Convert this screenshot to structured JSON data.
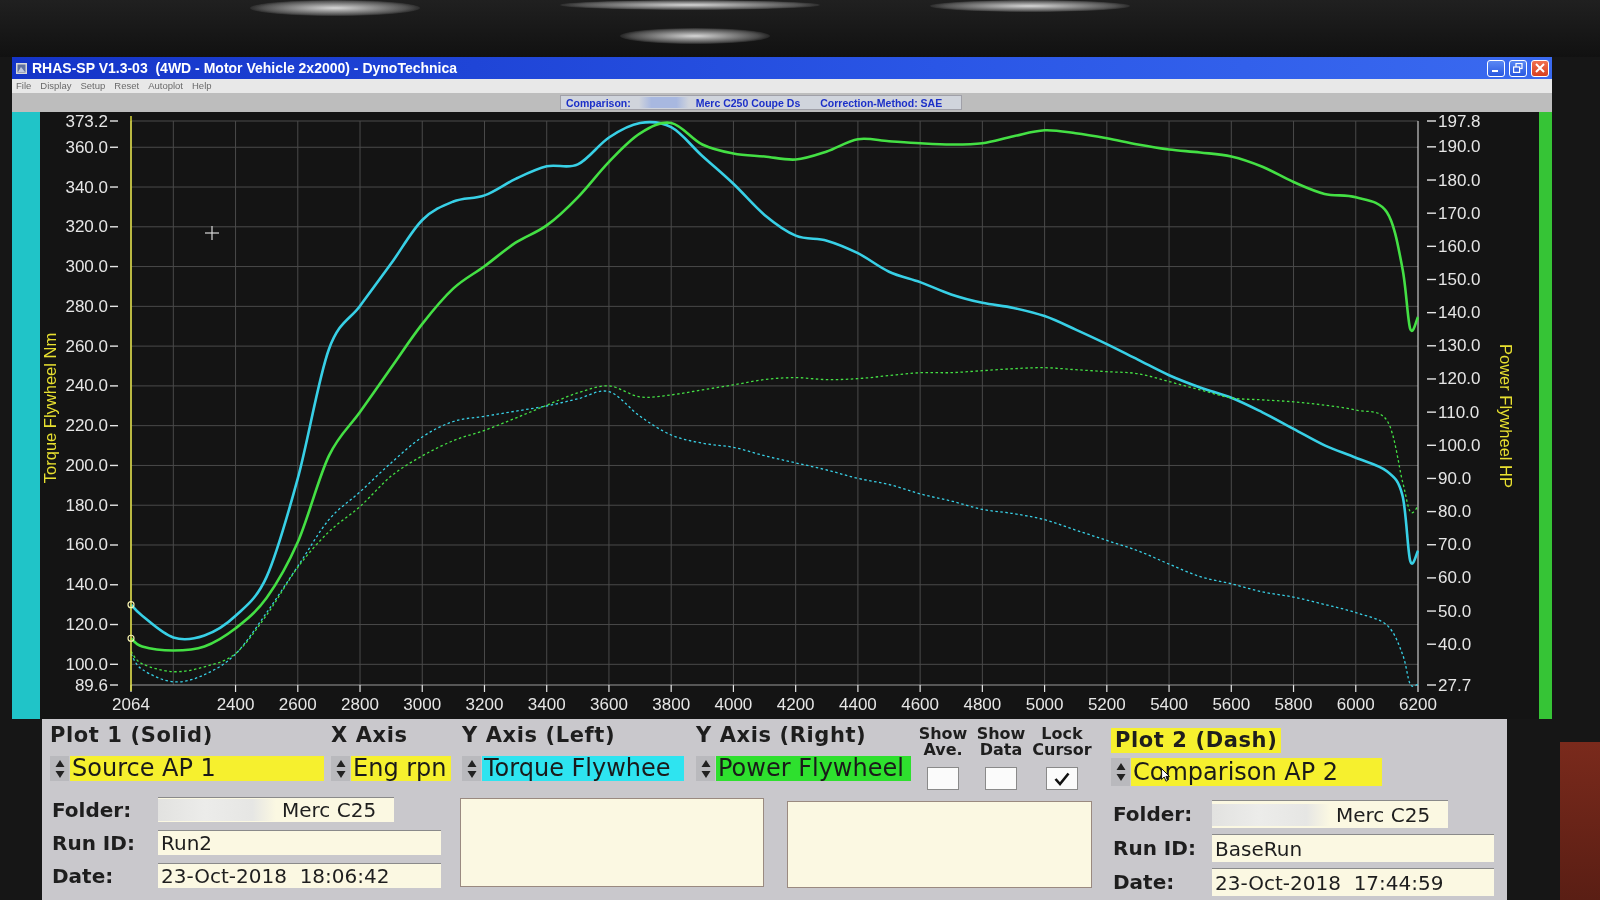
{
  "window": {
    "title": "RHAS-SP V1.3-03  (4WD - Motor Vehicle 2x2000) - DynoTechnica"
  },
  "menu": [
    "File",
    "Display",
    "Setup",
    "Reset",
    "Autoplot",
    "Help"
  ],
  "comparison_bar": {
    "label": "Comparison:",
    "redacted": true,
    "vehicle": "Merc C250 Coupe Ds",
    "correction": "Correction-Method: SAE"
  },
  "chart": {
    "chart_data": {
      "type": "line",
      "ylabel": "Torque Flywheel Nm",
      "y2label": "Power Flywheel HP",
      "grid": true,
      "x": [
        2064,
        2100,
        2200,
        2300,
        2400,
        2500,
        2600,
        2700,
        2800,
        2900,
        3000,
        3100,
        3200,
        3300,
        3400,
        3500,
        3600,
        3700,
        3800,
        3900,
        4000,
        4100,
        4200,
        4300,
        4400,
        4500,
        4600,
        4700,
        4800,
        4900,
        5000,
        5100,
        5200,
        5300,
        5400,
        5500,
        5600,
        5700,
        5800,
        5900,
        6000,
        6100,
        6150,
        6175,
        6200
      ],
      "xlim": [
        2064,
        6200
      ],
      "xticks": [
        2064,
        2400,
        2600,
        2800,
        3000,
        3200,
        3400,
        3600,
        3800,
        4000,
        4200,
        4400,
        4600,
        4800,
        5000,
        5200,
        5400,
        5600,
        5800,
        6000,
        6200
      ],
      "ylim": [
        89.6,
        373.2
      ],
      "yticks": [
        89.6,
        {
          "value": 100,
          "label": "100.0"
        },
        {
          "value": 120,
          "label": "120.0"
        },
        {
          "value": 140,
          "label": "140.0"
        },
        {
          "value": 160,
          "label": "160.0"
        },
        {
          "value": 180,
          "label": "180.0"
        },
        {
          "value": 200,
          "label": "200.0"
        },
        {
          "value": 220,
          "label": "220.0"
        },
        {
          "value": 240,
          "label": "240.0"
        },
        {
          "value": 260,
          "label": "260.0"
        },
        {
          "value": 280,
          "label": "280.0"
        },
        {
          "value": 300,
          "label": "300.0"
        },
        {
          "value": 320,
          "label": "320.0"
        },
        {
          "value": 340,
          "label": "340.0"
        },
        {
          "value": 360,
          "label": "360.0"
        },
        373.2
      ],
      "y2lim": [
        27.7,
        197.8
      ],
      "y2ticks": [
        27.7,
        {
          "value": 40,
          "label": "40.0"
        },
        {
          "value": 50,
          "label": "50.0"
        },
        {
          "value": 60,
          "label": "60.0"
        },
        {
          "value": 70,
          "label": "70.0"
        },
        {
          "value": 80,
          "label": "80.0"
        },
        {
          "value": 90,
          "label": "90.0"
        },
        {
          "value": 100,
          "label": "100.0"
        },
        {
          "value": 110,
          "label": "110.0"
        },
        {
          "value": 120,
          "label": "120.0"
        },
        {
          "value": 130,
          "label": "130.0"
        },
        {
          "value": 140,
          "label": "140.0"
        },
        {
          "value": 150,
          "label": "150.0"
        },
        {
          "value": 160,
          "label": "160.0"
        },
        {
          "value": 170,
          "label": "170.0"
        },
        {
          "value": 180,
          "label": "180.0"
        },
        {
          "value": 190,
          "label": "190.0"
        },
        197.8
      ],
      "series": [
        {
          "color": "#38d0e6",
          "line_style": "solid",
          "values": [
            130,
            124.4,
            113.5,
            114.5,
            124.4,
            144.1,
            193.5,
            258.4,
            280.2,
            301.5,
            323.4,
            332.7,
            335.8,
            344.1,
            350.4,
            351.4,
            364.9,
            372.2,
            370.1,
            355.6,
            341.6,
            326,
            315.6,
            313,
            306.7,
            297.4,
            292.2,
            286,
            281.8,
            279.2,
            275.1,
            268.3,
            261,
            253.2,
            245.4,
            239.2,
            234,
            226.7,
            218.4,
            210.1,
            203.9,
            197.1,
            185,
            152,
            157.1
          ]
        },
        {
          "color": "#44e044",
          "line_style": "solid",
          "axis": "y2",
          "values": [
            41.8,
            39.3,
            38.1,
            39.3,
            44.8,
            54,
            70.8,
            96.8,
            110,
            123.4,
            136.6,
            147.3,
            154,
            161.1,
            166.3,
            174.8,
            185.5,
            194.1,
            197.2,
            190.7,
            188,
            187.1,
            186.2,
            188.6,
            192.3,
            191.7,
            191.1,
            190.7,
            191.1,
            193.2,
            195,
            194.1,
            192.6,
            190.7,
            189.2,
            188.3,
            187.1,
            184,
            179.4,
            175.8,
            174.8,
            170.3,
            153.4,
            135.1,
            138.7
          ]
        },
        {
          "color": "#38d0e6",
          "line_style": "dashed",
          "values": [
            105.2,
            97.4,
            91.2,
            94.8,
            105.2,
            126,
            149.3,
            172.7,
            186.7,
            201.3,
            214.3,
            222.1,
            224.7,
            227.3,
            229.9,
            233.5,
            237.1,
            224.7,
            215.3,
            211.2,
            209.1,
            204.9,
            201.3,
            197.7,
            193.5,
            190.4,
            185.7,
            182.1,
            177.9,
            175.8,
            172.7,
            167.5,
            162.3,
            157.1,
            150.4,
            144.1,
            140.5,
            136.4,
            133.8,
            130.1,
            126,
            119.7,
            105.2,
            90,
            90
          ]
        },
        {
          "color": "#44e044",
          "line_style": "dashed",
          "axis": "y2",
          "values": [
            37.8,
            34.1,
            31.7,
            33.2,
            37.2,
            48.8,
            63.2,
            73.9,
            81.5,
            90.7,
            96.8,
            101.4,
            104.5,
            108.2,
            112.1,
            115.8,
            117.9,
            114.6,
            115.2,
            116.7,
            118.2,
            119.8,
            120.4,
            119.8,
            120.1,
            121,
            121.9,
            121.9,
            122.5,
            123.1,
            123.4,
            122.8,
            122.2,
            121.6,
            119.2,
            116.7,
            114.3,
            113.7,
            113.1,
            112.1,
            110.6,
            107.5,
            89.2,
            80,
            81.5
          ]
        }
      ],
      "ref_lines": [
        {
          "axis": "x",
          "value": 2064
        }
      ]
    }
  },
  "plot_1": {
    "title": "Plot 1 (Solid)",
    "highlighted": false,
    "source": {
      "value": "Source AP 1",
      "color": "#f6f02e"
    },
    "info": [
      {
        "label": "Folder:",
        "value": "Merc C25",
        "redacted": true
      },
      {
        "label": "Run ID:",
        "value": "Run2",
        "redacted": false
      },
      {
        "label": "Date:",
        "value": "23-Oct-2018  18:06:42",
        "redacted": false
      }
    ]
  },
  "axes": [
    {
      "header": "X Axis",
      "value": "Eng rpn",
      "color": "#f6f02e"
    },
    {
      "header": "Y Axis (Left)",
      "value": "Torque Flywhee",
      "color": "#2ee4f0"
    },
    {
      "header": "Y Axis (Right)",
      "value": "Power Flywheel",
      "color": "#2ee02e"
    }
  ],
  "options": [
    {
      "label": "Show Ave.",
      "checked": false
    },
    {
      "label": "Show Data",
      "checked": false
    },
    {
      "label": "Lock Cursor",
      "checked": true
    }
  ],
  "plot_2": {
    "title": "Plot 2 (Dash)",
    "highlighted": true,
    "source": {
      "value": "Comparison AP 2",
      "color": "#f6f02e"
    },
    "info": [
      {
        "label": "Folder:",
        "value": "Merc C25",
        "redacted": true
      },
      {
        "label": "Run ID:",
        "value": "BaseRun",
        "redacted": false
      },
      {
        "label": "Date:",
        "value": "23-Oct-2018  17:44:59",
        "redacted": false
      }
    ]
  }
}
